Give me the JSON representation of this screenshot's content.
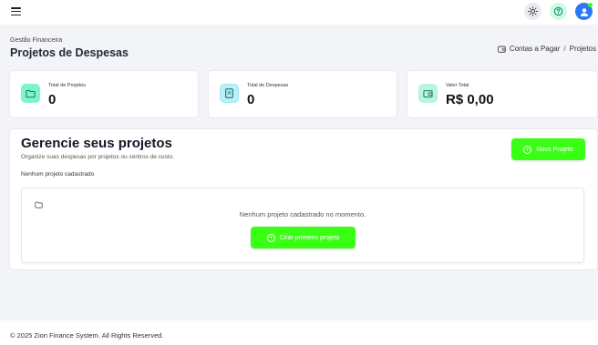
{
  "topbar": {
    "menu_icon": "hamburger-icon",
    "icons": [
      "sun-icon",
      "help-icon",
      "avatar-icon"
    ]
  },
  "header": {
    "subtitle": "Gestão Financeira",
    "title": "Projetos de Despesas",
    "breadcrumb": {
      "icon": "wallet-icon",
      "parent": "Contas a Pagar",
      "separator": "/",
      "current": "Projetos"
    }
  },
  "stats": [
    {
      "label": "Total de Projetos",
      "value": "0",
      "icon": "folder-icon",
      "icon_bg": "#7cf5c9"
    },
    {
      "label": "Total de Despesas",
      "value": "0",
      "icon": "document-icon",
      "icon_bg": "#bcf0f7"
    },
    {
      "label": "Valor Total",
      "value": "R$ 0,00",
      "icon": "wallet-icon",
      "icon_bg": "#b7f5dd"
    }
  ],
  "main": {
    "title": "Gerencie seus projetos",
    "subtitle": "Organize suas despesas por projetos ou centros de custo.",
    "new_button": "Novo Projeto",
    "empty_label": "Nenhum projeto cadastrado",
    "empty_message": "Nenhum projeto cadastrado no momento.",
    "create_first_button": "Criar primeiro projeto"
  },
  "footer": {
    "copyright": "© 2025 Zion Finance System. All Rights Reserved."
  },
  "colors": {
    "accent": "#39ff14",
    "avatar": "#2a78f5",
    "background": "#f3f4f7"
  }
}
